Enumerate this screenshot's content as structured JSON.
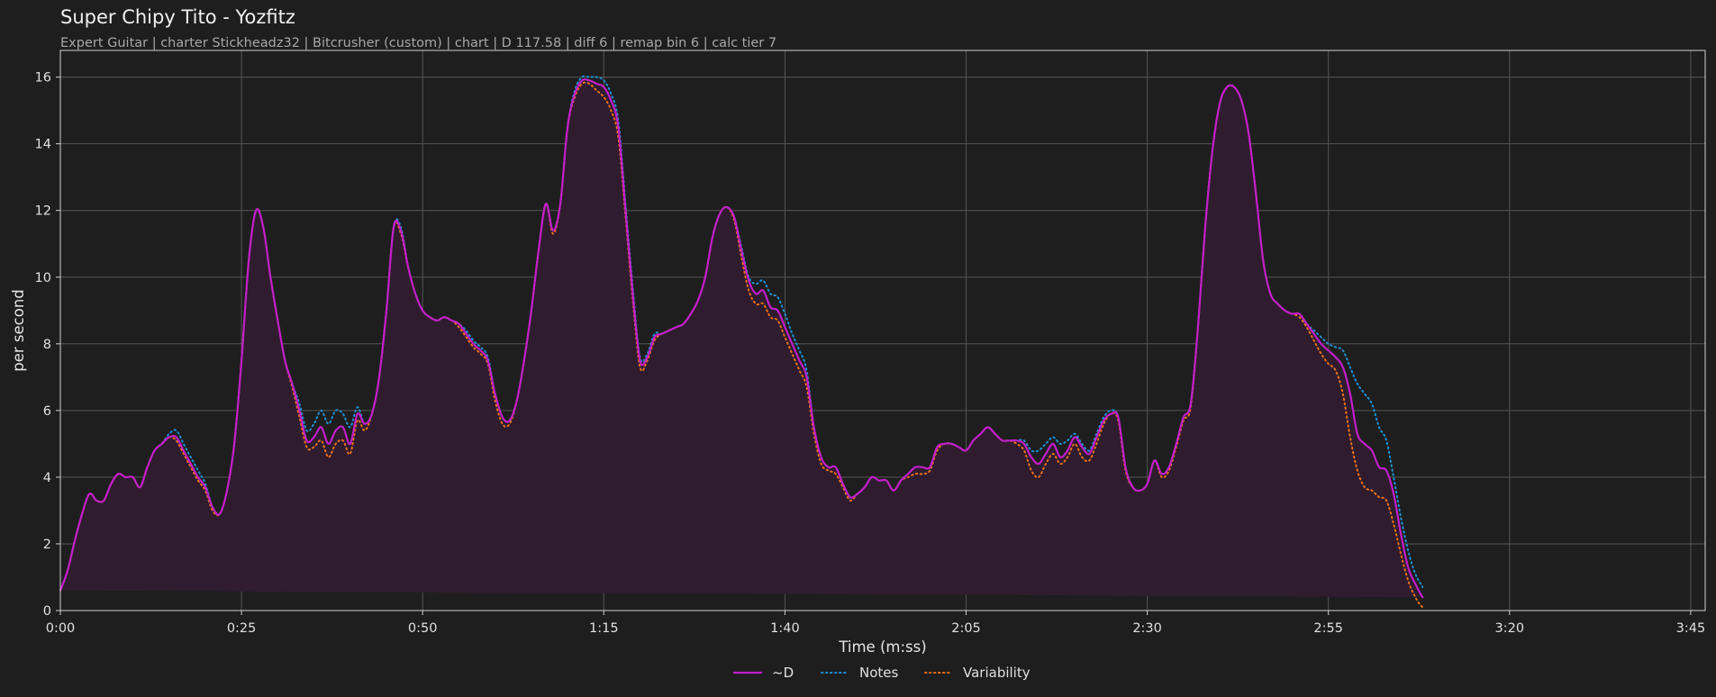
{
  "header": {
    "title": "Super Chipy Tito - Yozfitz",
    "subtitle": "Expert Guitar  |  charter Stickheadz32  |  Bitcrusher (custom)  |  chart  |  D 117.58  |  diff 6  |  remap bin 6  |  calc tier 7"
  },
  "colors": {
    "background": "#1e1e1e",
    "d_line": "#c21ec8",
    "d_fill": "#2f1c2f",
    "notes_line": "#1f8fd0",
    "variability_line": "#e8701a",
    "grid": "#555555"
  },
  "chart_data": {
    "type": "line",
    "title": "Super Chipy Tito - Yozfitz",
    "subtitle": "Expert Guitar  |  charter Stickheadz32  |  Bitcrusher (custom)  |  chart  |  D 117.58  |  diff 6  |  remap bin 6  |  calc tier 7",
    "xlabel": "Time (m:ss)",
    "ylabel": "per second",
    "xlim": [
      0,
      227
    ],
    "ylim": [
      0,
      16.8
    ],
    "x_ticks": [
      0,
      25,
      50,
      75,
      100,
      125,
      150,
      175,
      200,
      225
    ],
    "x_tick_labels": [
      "0:00",
      "0:25",
      "0:50",
      "1:15",
      "1:40",
      "2:05",
      "2:30",
      "2:55",
      "3:20",
      "3:45"
    ],
    "y_ticks": [
      0,
      2,
      4,
      6,
      8,
      10,
      12,
      14,
      16
    ],
    "y_tick_labels": [
      "0",
      "2",
      "4",
      "6",
      "8",
      "10",
      "12",
      "14",
      "16"
    ],
    "grid": true,
    "legend_position": "bottom-center",
    "x": [
      0,
      1,
      2,
      3,
      4,
      5,
      6,
      7,
      8,
      9,
      10,
      11,
      12,
      13,
      14,
      15,
      16,
      17,
      18,
      19,
      20,
      21,
      22,
      23,
      24,
      25,
      26,
      27,
      28,
      29,
      30,
      31,
      32,
      33,
      34,
      35,
      36,
      37,
      38,
      39,
      40,
      41,
      42,
      43,
      44,
      45,
      46,
      47,
      48,
      49,
      50,
      51,
      52,
      53,
      54,
      55,
      56,
      57,
      58,
      59,
      60,
      61,
      62,
      63,
      64,
      65,
      66,
      67,
      68,
      69,
      70,
      71,
      72,
      73,
      74,
      75,
      76,
      77,
      78,
      79,
      80,
      81,
      82,
      83,
      84,
      85,
      86,
      87,
      88,
      89,
      90,
      91,
      92,
      93,
      94,
      95,
      96,
      97,
      98,
      99,
      100,
      101,
      102,
      103,
      104,
      105,
      106,
      107,
      108,
      109,
      110,
      111,
      112,
      113,
      114,
      115,
      116,
      117,
      118,
      119,
      120,
      121,
      122,
      123,
      124,
      125,
      126,
      127,
      128,
      129,
      130,
      131,
      132,
      133,
      134,
      135,
      136,
      137,
      138,
      139,
      140,
      141,
      142,
      143,
      144,
      145,
      146,
      147,
      148,
      149,
      150,
      151,
      152,
      153,
      154,
      155,
      156,
      157,
      158,
      159,
      160,
      161,
      162,
      163,
      164,
      165,
      166,
      167,
      168,
      169,
      170,
      171,
      172,
      173,
      174,
      175,
      176,
      177,
      178,
      179,
      180,
      181,
      182,
      183,
      184,
      185,
      186,
      187,
      188,
      189,
      190,
      191,
      192,
      193,
      194,
      195,
      196,
      197,
      198,
      199,
      200,
      201,
      202,
      203,
      204,
      205,
      206,
      207,
      208,
      209,
      210,
      211,
      212,
      213,
      214,
      215,
      216,
      217,
      218,
      219,
      220,
      221,
      222,
      223,
      224,
      225,
      226,
      227
    ],
    "series": [
      {
        "name": "~D",
        "style": "solid",
        "values": [
          0.6,
          1.2,
          2.1,
          2.9,
          3.5,
          3.3,
          3.3,
          3.8,
          4.1,
          4.0,
          4.0,
          3.7,
          4.3,
          4.8,
          5.0,
          5.2,
          5.2,
          4.8,
          4.4,
          4.0,
          3.7,
          3.1,
          2.9,
          3.6,
          5.0,
          7.5,
          10.5,
          12.0,
          11.5,
          10.0,
          8.7,
          7.5,
          6.8,
          6.0,
          5.1,
          5.2,
          5.5,
          5.0,
          5.4,
          5.5,
          5.0,
          5.9,
          5.6,
          5.9,
          7.0,
          9.0,
          11.5,
          11.4,
          10.3,
          9.5,
          9.0,
          8.8,
          8.7,
          8.8,
          8.7,
          8.6,
          8.3,
          8.0,
          7.8,
          7.5,
          6.5,
          5.8,
          5.7,
          6.3,
          7.5,
          9.0,
          10.8,
          12.2,
          11.4,
          12.2,
          14.5,
          15.5,
          15.9,
          15.9,
          15.8,
          15.7,
          15.3,
          14.5,
          12.0,
          9.5,
          7.5,
          7.6,
          8.2,
          8.3,
          8.4,
          8.5,
          8.6,
          8.9,
          9.3,
          10.0,
          11.2,
          11.9,
          12.1,
          11.8,
          10.8,
          9.9,
          9.5,
          9.6,
          9.1,
          9.0,
          8.5,
          8.0,
          7.5,
          7.0,
          5.5,
          4.6,
          4.3,
          4.3,
          3.8,
          3.4,
          3.5,
          3.7,
          4.0,
          3.9,
          3.9,
          3.6,
          3.9,
          4.1,
          4.3,
          4.3,
          4.3,
          4.9,
          5.0,
          5.0,
          4.9,
          4.8,
          5.1,
          5.3,
          5.5,
          5.3,
          5.1,
          5.1,
          5.1,
          5.0,
          4.6,
          4.4,
          4.7,
          5.0,
          4.6,
          4.8,
          5.2,
          4.9,
          4.7,
          5.2,
          5.7,
          5.9,
          5.8,
          4.3,
          3.7,
          3.6,
          3.8,
          4.5,
          4.1,
          4.3,
          5.0,
          5.8,
          6.2,
          8.5,
          11.5,
          13.8,
          15.2,
          15.7,
          15.7,
          15.3,
          14.3,
          12.5,
          10.5,
          9.5,
          9.2,
          9.0,
          8.9,
          8.9,
          8.6,
          8.3,
          8.0,
          7.8,
          7.6,
          7.3,
          6.5,
          5.3,
          5.0,
          4.8,
          4.3,
          4.2,
          3.5,
          2.3,
          1.3,
          0.8,
          0.4,
          0.1
        ]
      },
      {
        "name": "Notes",
        "style": "dotted",
        "values": [
          0.6,
          1.2,
          2.1,
          2.9,
          3.5,
          3.3,
          3.3,
          3.8,
          4.1,
          4.0,
          4.0,
          3.7,
          4.3,
          4.8,
          5.0,
          5.3,
          5.4,
          5.0,
          4.6,
          4.2,
          3.8,
          3.1,
          2.9,
          3.6,
          5.0,
          7.5,
          10.5,
          12.0,
          11.5,
          10.0,
          8.7,
          7.5,
          6.8,
          6.2,
          5.4,
          5.6,
          6.0,
          5.6,
          6.0,
          5.9,
          5.5,
          6.1,
          5.6,
          5.9,
          7.0,
          9.0,
          11.5,
          11.5,
          10.3,
          9.5,
          9.0,
          8.8,
          8.7,
          8.8,
          8.7,
          8.6,
          8.4,
          8.1,
          7.9,
          7.6,
          6.5,
          5.8,
          5.7,
          6.3,
          7.5,
          9.0,
          10.8,
          12.2,
          11.4,
          12.2,
          14.5,
          15.6,
          16.0,
          16.0,
          16.0,
          15.9,
          15.5,
          14.7,
          12.2,
          9.7,
          7.6,
          7.7,
          8.3,
          8.3,
          8.4,
          8.5,
          8.6,
          8.9,
          9.3,
          10.0,
          11.2,
          11.9,
          12.1,
          11.8,
          10.9,
          10.0,
          9.8,
          9.9,
          9.5,
          9.4,
          8.9,
          8.3,
          7.8,
          7.2,
          5.5,
          4.6,
          4.3,
          4.3,
          3.8,
          3.4,
          3.5,
          3.7,
          4.0,
          3.9,
          3.9,
          3.6,
          3.9,
          4.1,
          4.3,
          4.3,
          4.3,
          4.9,
          5.0,
          5.0,
          4.9,
          4.8,
          5.1,
          5.3,
          5.5,
          5.3,
          5.1,
          5.1,
          5.1,
          5.1,
          4.8,
          4.8,
          5.0,
          5.2,
          5.0,
          5.1,
          5.3,
          5.0,
          4.8,
          5.3,
          5.8,
          6.0,
          5.8,
          4.3,
          3.7,
          3.6,
          3.8,
          4.5,
          4.1,
          4.3,
          5.0,
          5.8,
          6.2,
          8.5,
          11.5,
          13.8,
          15.2,
          15.7,
          15.7,
          15.3,
          14.3,
          12.5,
          10.5,
          9.5,
          9.2,
          9.0,
          8.9,
          8.9,
          8.6,
          8.4,
          8.2,
          8.0,
          7.9,
          7.8,
          7.3,
          6.8,
          6.5,
          6.2,
          5.5,
          5.1,
          4.0,
          2.8,
          1.8,
          1.1,
          0.7,
          0.3
        ]
      },
      {
        "name": "Variability",
        "style": "dotted",
        "values": [
          0.6,
          1.2,
          2.1,
          2.9,
          3.5,
          3.3,
          3.3,
          3.8,
          4.1,
          4.0,
          4.0,
          3.7,
          4.3,
          4.8,
          5.0,
          5.2,
          5.1,
          4.7,
          4.3,
          3.9,
          3.6,
          3.0,
          2.9,
          3.6,
          5.0,
          7.5,
          10.5,
          12.0,
          11.5,
          10.0,
          8.7,
          7.5,
          6.7,
          5.8,
          4.9,
          4.9,
          5.1,
          4.6,
          5.0,
          5.1,
          4.7,
          5.7,
          5.4,
          5.9,
          7.0,
          9.0,
          11.5,
          11.3,
          10.3,
          9.5,
          9.0,
          8.8,
          8.7,
          8.8,
          8.7,
          8.5,
          8.2,
          7.9,
          7.7,
          7.4,
          6.3,
          5.6,
          5.6,
          6.3,
          7.5,
          9.0,
          10.8,
          12.2,
          11.3,
          12.2,
          14.5,
          15.4,
          15.8,
          15.8,
          15.6,
          15.4,
          15.0,
          14.2,
          11.8,
          9.3,
          7.3,
          7.5,
          8.1,
          8.3,
          8.4,
          8.5,
          8.6,
          8.9,
          9.3,
          10.0,
          11.2,
          11.9,
          12.1,
          11.7,
          10.6,
          9.6,
          9.2,
          9.2,
          8.8,
          8.7,
          8.2,
          7.7,
          7.2,
          6.7,
          5.3,
          4.4,
          4.2,
          4.1,
          3.7,
          3.3,
          3.5,
          3.7,
          4.0,
          3.9,
          3.9,
          3.6,
          3.9,
          4.0,
          4.1,
          4.1,
          4.2,
          4.8,
          5.0,
          5.0,
          4.9,
          4.8,
          5.1,
          5.3,
          5.5,
          5.3,
          5.1,
          5.1,
          5.0,
          4.8,
          4.2,
          4.0,
          4.4,
          4.7,
          4.4,
          4.6,
          5.0,
          4.6,
          4.5,
          5.0,
          5.6,
          5.9,
          5.7,
          4.2,
          3.7,
          3.6,
          3.8,
          4.5,
          4.0,
          4.2,
          4.9,
          5.7,
          6.1,
          8.5,
          11.5,
          13.8,
          15.2,
          15.7,
          15.7,
          15.3,
          14.3,
          12.5,
          10.5,
          9.5,
          9.2,
          9.0,
          8.9,
          8.8,
          8.5,
          8.1,
          7.7,
          7.4,
          7.2,
          6.5,
          5.2,
          4.2,
          3.7,
          3.6,
          3.4,
          3.3,
          2.6,
          1.7,
          0.9,
          0.4,
          0.1,
          0.0
        ]
      }
    ]
  }
}
